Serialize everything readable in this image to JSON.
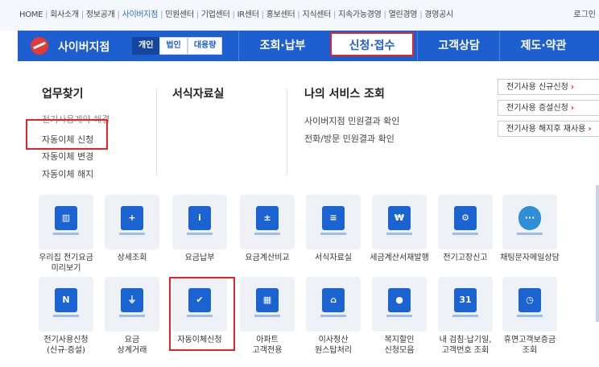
{
  "top": {
    "links": [
      "HOME",
      "회사소개",
      "정보공개",
      "사이버지점",
      "민원센터",
      "기업센터",
      "IR센터",
      "홍보센터",
      "지식센터",
      "지속가능경영",
      "열린경영",
      "경영공시"
    ],
    "current_index": 3,
    "login": "로그인"
  },
  "nav": {
    "brand": "사이버지점",
    "pills": [
      "개인",
      "법인",
      "대용량"
    ],
    "items": [
      "조회·납부",
      "신청·접수",
      "고객상담",
      "제도·약관"
    ]
  },
  "mega": {
    "col1": {
      "title": "업무찾기",
      "links": [
        "전기사용계약 해결",
        "자동이체 신청",
        "자동이체 변경",
        "자동이체 해지"
      ]
    },
    "col2": {
      "title": "서식자료실"
    },
    "col3": {
      "title": "나의 서비스 조회",
      "links": [
        "사이버지점 민원결과 확인",
        "전화/방문 민원결과 확인"
      ]
    },
    "quick": [
      "전기사용 신규신청",
      "전기사용 증설신청",
      "전기사용 해지후 재사용"
    ]
  },
  "tiles": [
    {
      "label": "우리집 전기요금\n미리보기",
      "icon": "chart-book-icon",
      "glyph": "▥"
    },
    {
      "label": "상세조회",
      "icon": "magnify-book-icon",
      "glyph": "+"
    },
    {
      "label": "요금납부",
      "icon": "info-book-icon",
      "glyph": "i"
    },
    {
      "label": "요금계산비교",
      "icon": "calculator-icon",
      "glyph": "±"
    },
    {
      "label": "서식자료실",
      "icon": "form-list-icon",
      "glyph": "≡"
    },
    {
      "label": "세금계산서재발행",
      "icon": "won-invoice-icon",
      "glyph": "₩"
    },
    {
      "label": "전기고장신고",
      "icon": "wrench-icon",
      "glyph": "⚙"
    },
    {
      "label": "채팅문자메일상담",
      "icon": "chat-bubble-icon",
      "glyph": "···"
    },
    {
      "label": "전기사용신청\n(신규·증설)",
      "icon": "new-book-icon",
      "glyph": "N"
    },
    {
      "label": "요금\n상계거래",
      "icon": "plug-icon",
      "glyph": "⏚"
    },
    {
      "label": "자동이체신청",
      "icon": "checklist-icon",
      "glyph": "✔"
    },
    {
      "label": "아파트\n고객전용",
      "icon": "apartment-icon",
      "glyph": "▦"
    },
    {
      "label": "이사정산\n원스탑처리",
      "icon": "house-icon",
      "glyph": "⌂"
    },
    {
      "label": "복지할인\n신청모음",
      "icon": "person-card-icon",
      "glyph": "●"
    },
    {
      "label": "내 검침·납기일,\n고객번호 조회",
      "icon": "calendar-icon",
      "glyph": "31"
    },
    {
      "label": "휴면고객보증금\n조회",
      "icon": "deposit-icon",
      "glyph": "◷"
    }
  ]
}
